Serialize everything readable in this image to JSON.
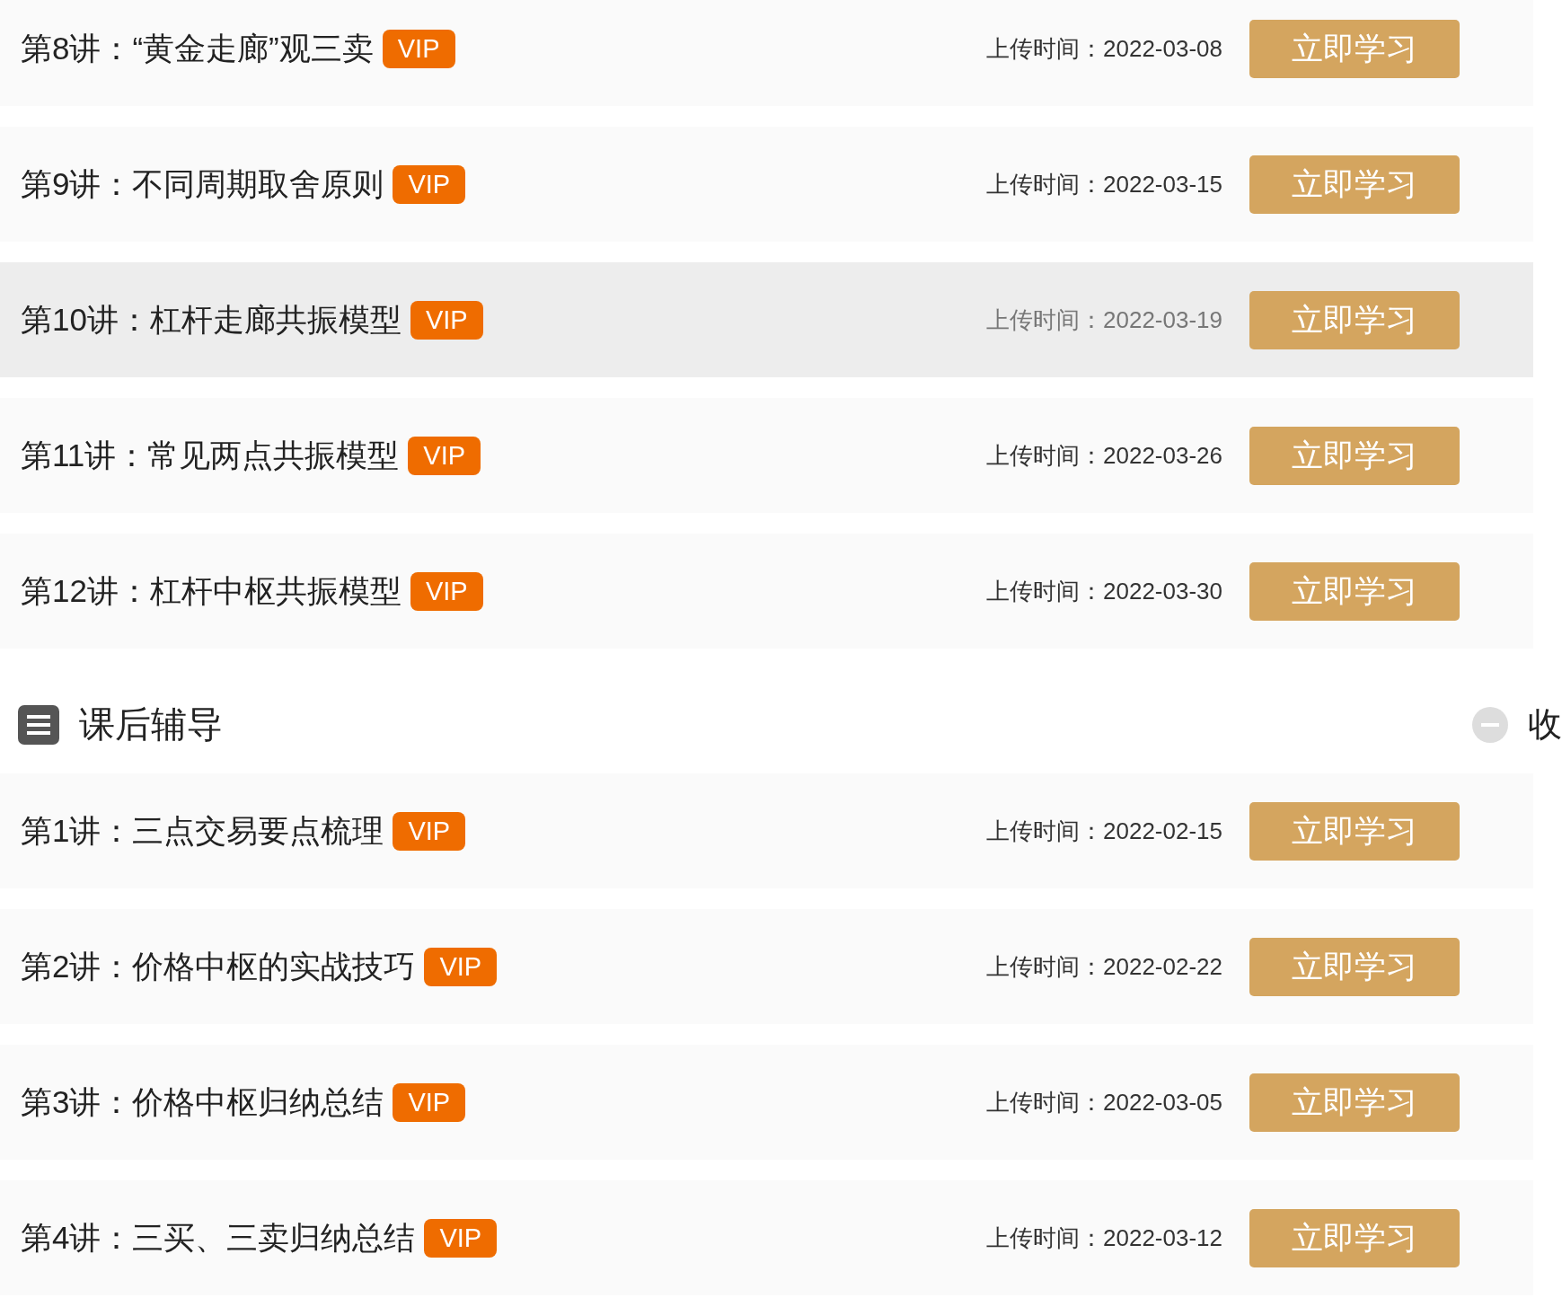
{
  "sections": [
    {
      "lessons": [
        {
          "title": "第8讲：“黄金走廊”观三卖",
          "badge": "VIP",
          "upload": "上传时间：2022-03-08",
          "button": "立即学习",
          "highlighted": false
        },
        {
          "title": "第9讲：不同周期取舍原则",
          "badge": "VIP",
          "upload": "上传时间：2022-03-15",
          "button": "立即学习",
          "highlighted": false
        },
        {
          "title": "第10讲：杠杆走廊共振模型",
          "badge": "VIP",
          "upload": "上传时间：2022-03-19",
          "button": "立即学习",
          "highlighted": true
        },
        {
          "title": "第11讲：常见两点共振模型",
          "badge": "VIP",
          "upload": "上传时间：2022-03-26",
          "button": "立即学习",
          "highlighted": false
        },
        {
          "title": "第12讲：杠杆中枢共振模型",
          "badge": "VIP",
          "upload": "上传时间：2022-03-30",
          "button": "立即学习",
          "highlighted": false
        }
      ]
    },
    {
      "header": {
        "title": "课后辅导",
        "toggle": "收"
      },
      "lessons": [
        {
          "title": "第1讲：三点交易要点梳理",
          "badge": "VIP",
          "upload": "上传时间：2022-02-15",
          "button": "立即学习",
          "highlighted": false
        },
        {
          "title": "第2讲：价格中枢的实战技巧",
          "badge": "VIP",
          "upload": "上传时间：2022-02-22",
          "button": "立即学习",
          "highlighted": false
        },
        {
          "title": "第3讲：价格中枢归纳总结",
          "badge": "VIP",
          "upload": "上传时间：2022-03-05",
          "button": "立即学习",
          "highlighted": false
        },
        {
          "title": "第4讲：三买、三卖归纳总结",
          "badge": "VIP",
          "upload": "上传时间：2022-03-12",
          "button": "立即学习",
          "highlighted": false
        }
      ]
    }
  ]
}
